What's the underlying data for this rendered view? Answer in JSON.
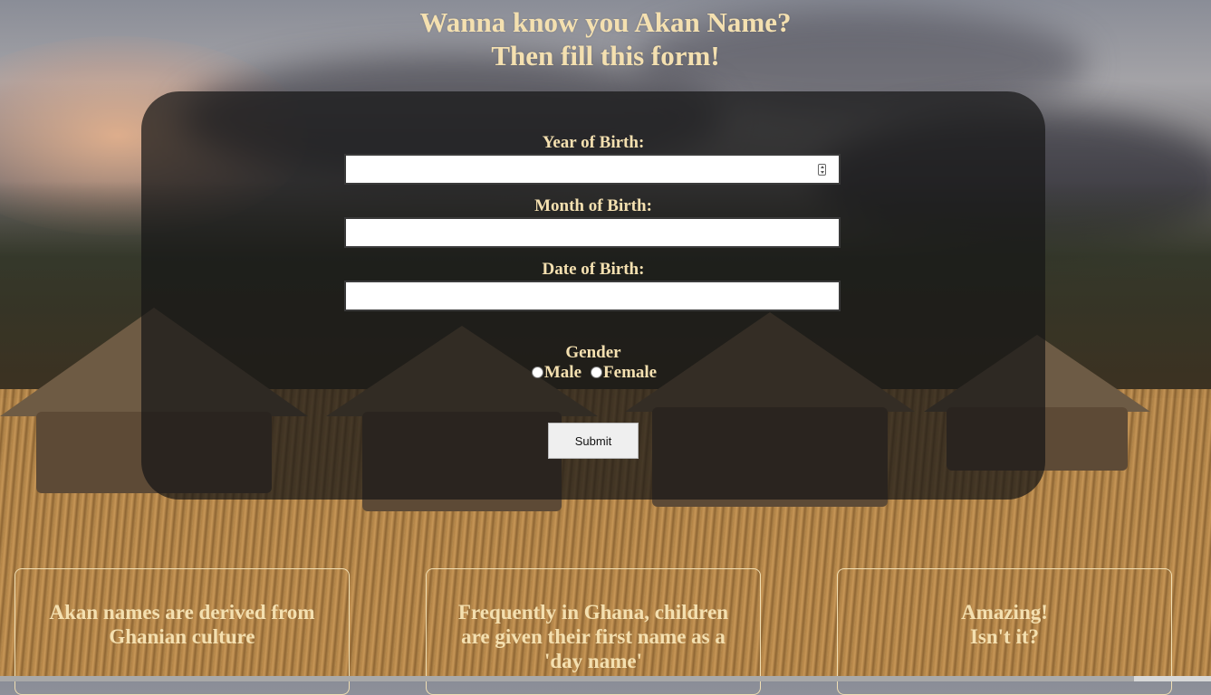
{
  "heading": {
    "line1": "Wanna know you Akan Name?",
    "line2": "Then fill this form!"
  },
  "form": {
    "year_label": "Year of Birth:",
    "year_value": "",
    "month_label": "Month of Birth:",
    "month_value": "",
    "date_label": "Date of Birth:",
    "date_value": "",
    "gender_label": "Gender",
    "gender_options": [
      "Male",
      "Female"
    ],
    "submit_label": "Submit"
  },
  "cards": [
    {
      "lines": [
        "Akan names are derived from",
        "Ghanian culture"
      ]
    },
    {
      "lines": [
        "Frequently in Ghana, children",
        "are given their first name as a",
        "'day name'"
      ]
    },
    {
      "lines": [
        "Amazing!",
        "Isn't it?"
      ]
    }
  ],
  "colors": {
    "text_accent": "#f4e0b0",
    "panel_bg": "rgba(22,22,22,0.72)",
    "input_bg": "#ffffff"
  },
  "icons": {
    "number_spinner": "number-spinner-icon"
  }
}
